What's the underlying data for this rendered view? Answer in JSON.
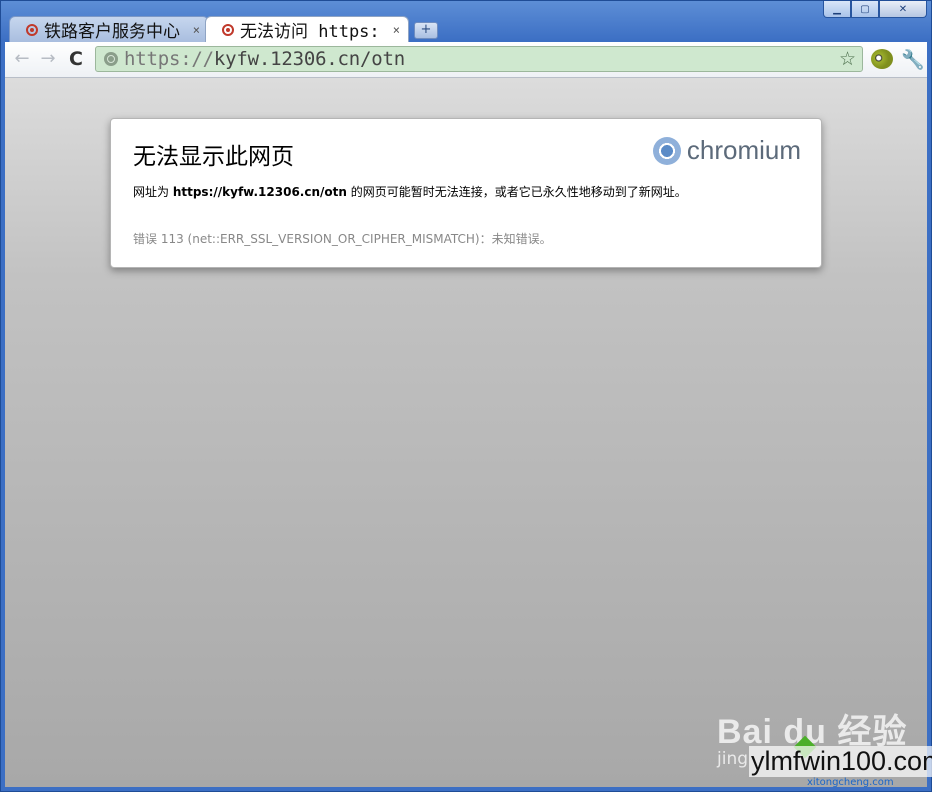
{
  "window": {
    "controls": {
      "minimize": "▁",
      "maximize": "▢",
      "close": "✕"
    }
  },
  "tabs": [
    {
      "title": "铁路客户服务中心",
      "close": "×",
      "active": false
    },
    {
      "title": "无法访问 https:",
      "close": "×",
      "active": true
    }
  ],
  "new_tab_label": "+",
  "toolbar": {
    "back_icon": "←",
    "forward_icon": "→",
    "reload_icon": "C",
    "url_scheme": "https://",
    "url_rest": "kyfw.12306.cn/otn",
    "bookmark_icon": "☆",
    "wrench_icon": "🔧"
  },
  "error": {
    "heading": "无法显示此网页",
    "logo_text": "chromium",
    "message_prefix": "网址为 ",
    "message_url": "https://kyfw.12306.cn/otn",
    "message_suffix": " 的网页可能暂时无法连接，或者它已永久性地移动到了新网址。",
    "code_text": "错误 113 (net::ERR_SSL_VERSION_OR_CIPHER_MISMATCH)：未知错误。"
  },
  "watermark": {
    "baidu": "Bai du 经验",
    "jing": "jing",
    "site": "ylmfwin100.com",
    "site_sub": "xitongcheng.com"
  },
  "colors": {
    "omnibox_bg": "#cfe8cf",
    "frame": "#3c6fc4"
  }
}
